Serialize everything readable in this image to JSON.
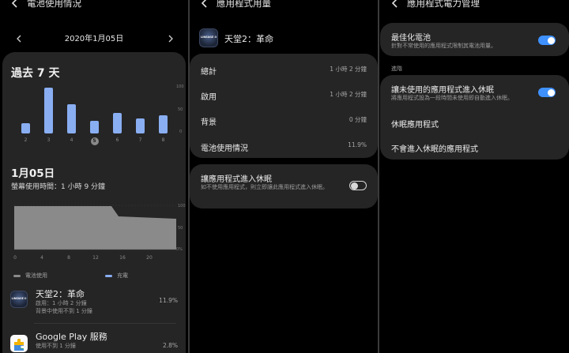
{
  "panel1": {
    "title": "電池使用情況",
    "date": "2020年1月05日",
    "range_title": "過去 7 天",
    "bars": [
      {
        "day": "2",
        "value": 22
      },
      {
        "day": "3",
        "value": 100
      },
      {
        "day": "4",
        "value": 63
      },
      {
        "day": "5",
        "value": 28,
        "selected": true
      },
      {
        "day": "6",
        "value": 45
      },
      {
        "day": "7",
        "value": 33
      },
      {
        "day": "8",
        "value": 40
      }
    ],
    "bar_y_ticks": [
      "100",
      "50",
      "0"
    ],
    "day_title": "1月05日",
    "screen_time": "螢幕使用時間：1 小時 9 分鐘",
    "area_x_ticks": [
      "0",
      "4",
      "8",
      "12",
      "16",
      "20"
    ],
    "area_y_ticks": [
      "100",
      "50",
      "0%"
    ],
    "legend_battery": "電池使用",
    "legend_charge": "充電",
    "apps": [
      {
        "name": "天堂2：革命",
        "line1": "啟用：1 小時 2 分鐘",
        "line2": "背景中使用不到 1 分鐘",
        "percent": "11.9%"
      },
      {
        "name": "Google Play 服務",
        "line1": "使用不到 1 分鐘",
        "line2": "",
        "percent": "2.8%"
      }
    ]
  },
  "panel2": {
    "title": "應用程式用量",
    "app_name": "天堂2：革命",
    "rows": [
      {
        "label": "總計",
        "value": "1 小時 2 分鐘"
      },
      {
        "label": "啟用",
        "value": "1 小時 2 分鐘"
      },
      {
        "label": "背景",
        "value": "0 分鐘"
      },
      {
        "label": "電池使用情況",
        "value": "11.9%"
      }
    ],
    "sleep_title": "讓應用程式進入休眠",
    "sleep_desc": "如不使用應用程式，則立即讓此應用程式進入休眠。"
  },
  "panel3": {
    "title": "應用程式電力管理",
    "optimize_title": "最佳化電池",
    "optimize_desc": "針對不常使用的應用程式限制其電池用量。",
    "advanced_label": "進階",
    "sleep_unused_title": "讓未使用的應用程式進入休眠",
    "sleep_unused_desc": "將應用程式設為一段時間未使用即自動進入休眠。",
    "sleeping_apps": "休眠應用程式",
    "never_sleeping_apps": "不會進入休眠的應用程式"
  },
  "logo_text": "LINEAGE II",
  "colors": {
    "accent": "#3e91ff",
    "bar": "#89aef2",
    "card": "#252525"
  }
}
